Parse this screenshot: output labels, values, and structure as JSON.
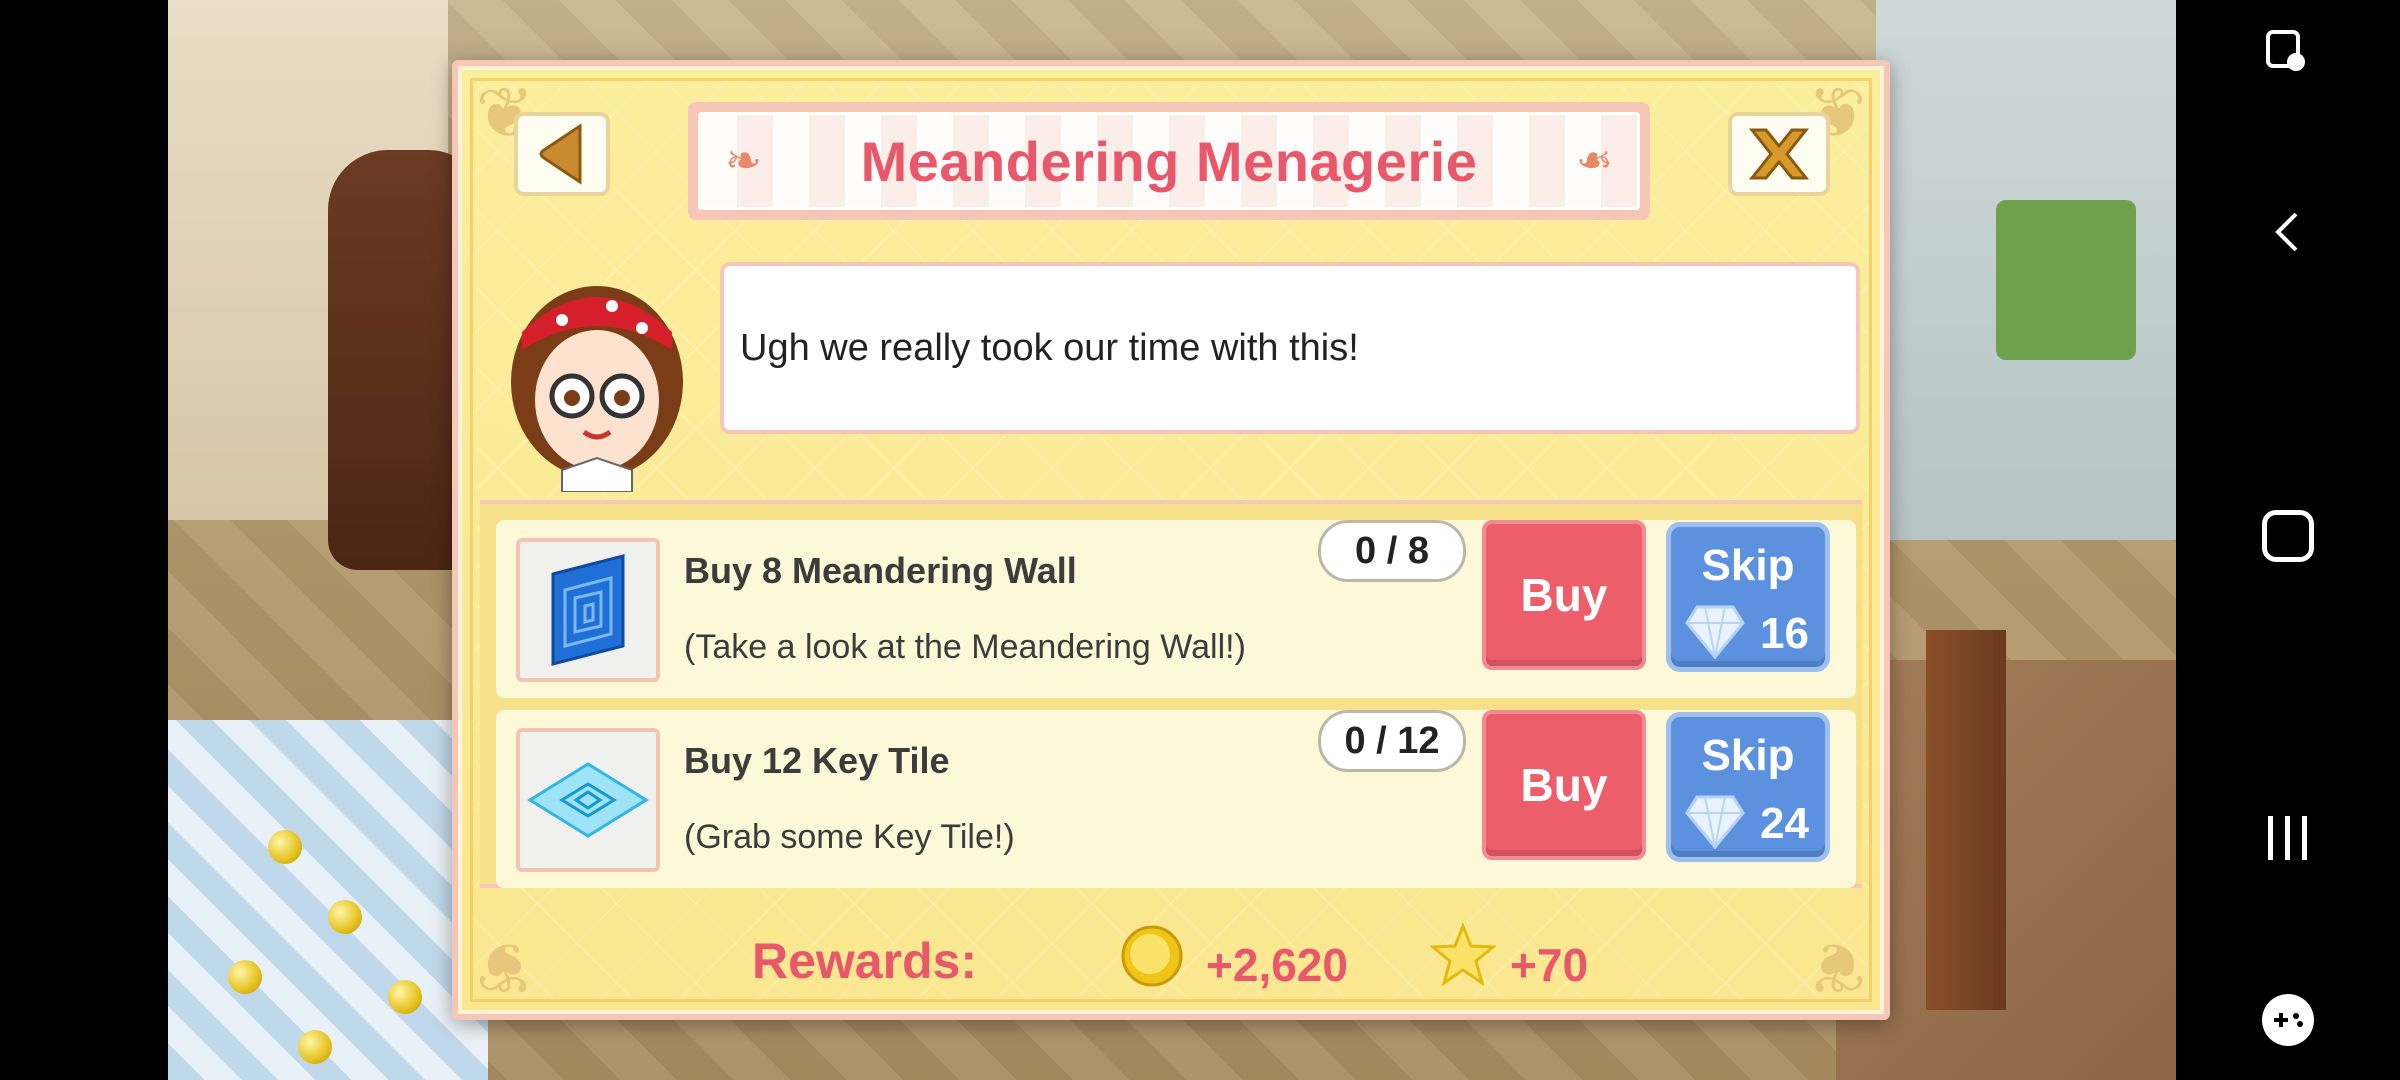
{
  "dialog": {
    "title": "Meandering Menagerie",
    "message": "Ugh we really took our time with this!",
    "close_label": "X"
  },
  "tasks": [
    {
      "name": "Buy 8 Meandering Wall",
      "description": "(Take a look at the Meandering Wall!)",
      "progress": "0 / 8",
      "buy_label": "Buy",
      "skip_label": "Skip",
      "skip_cost": "16",
      "thumb_icon": "meandering-wall-icon"
    },
    {
      "name": "Buy 12 Key Tile",
      "description": "(Grab some Key Tile!)",
      "progress": "0 / 12",
      "buy_label": "Buy",
      "skip_label": "Skip",
      "skip_cost": "24",
      "thumb_icon": "key-tile-icon"
    }
  ],
  "rewards": {
    "label": "Rewards:",
    "coins": "+2,620",
    "stars": "+70"
  },
  "colors": {
    "title": "#e9576a",
    "buy": "#ec5e6a",
    "skip": "#5b91de",
    "panel": "#fae78f"
  }
}
